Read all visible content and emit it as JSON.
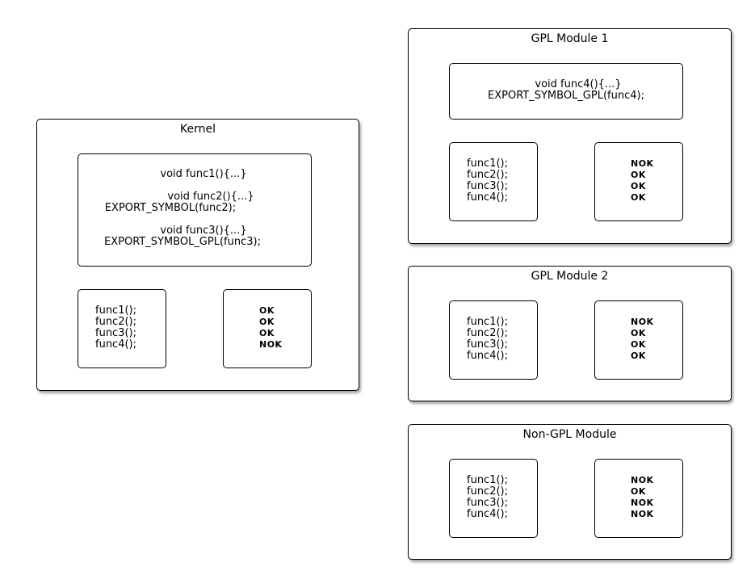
{
  "kernel": {
    "title": "Kernel",
    "code": {
      "func1": "void func1(){...}",
      "func2": "void func2(){...}",
      "func2_export": "EXPORT_SYMBOL(func2);",
      "func3": "void func3(){...}",
      "func3_export": "EXPORT_SYMBOL_GPL(func3);"
    },
    "calls": [
      "func1();",
      "func2();",
      "func3();",
      "func4();"
    ],
    "results": [
      "OK",
      "OK",
      "OK",
      "NOK"
    ]
  },
  "gpl_module_1": {
    "title": "GPL Module 1",
    "code": {
      "func4": "void func4(){...}",
      "func4_export": "EXPORT_SYMBOL_GPL(func4);"
    },
    "calls": [
      "func1();",
      "func2();",
      "func3();",
      "func4();"
    ],
    "results": [
      "NOK",
      "OK",
      "OK",
      "OK"
    ]
  },
  "gpl_module_2": {
    "title": "GPL Module 2",
    "calls": [
      "func1();",
      "func2();",
      "func3();",
      "func4();"
    ],
    "results": [
      "NOK",
      "OK",
      "OK",
      "OK"
    ]
  },
  "non_gpl_module": {
    "title": "Non-GPL Module",
    "calls": [
      "func1();",
      "func2();",
      "func3();",
      "func4();"
    ],
    "results": [
      "NOK",
      "OK",
      "NOK",
      "NOK"
    ]
  }
}
